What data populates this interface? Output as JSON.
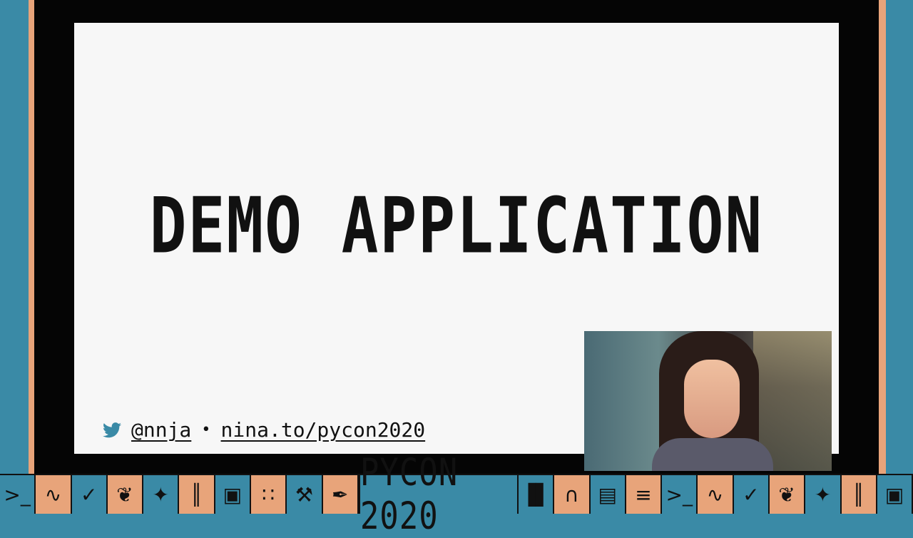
{
  "slide": {
    "title": "DEMO APPLICATION",
    "footer": {
      "twitter_handle": "@nnja",
      "separator": "•",
      "link": "nina.to/pycon2020"
    }
  },
  "branding": {
    "event_logo": "PYCON 2020"
  },
  "colors": {
    "teal": "#3a8aa6",
    "peach": "#e8a47a",
    "frame": "#050505",
    "slide_bg": "#f7f7f7",
    "twitter_blue": "#3a8aa6"
  },
  "icons": {
    "footer_icon": "twitter-icon",
    "bottom_bar_left": [
      "terminal-icon",
      "snake-icon",
      "check-icon",
      "laurel-icon",
      "star-icon",
      "pipes-icon",
      "robot-icon",
      "console-icon",
      "pipes-icon",
      "wrench-icon",
      "pen-icon",
      "bars-icon",
      "arch-icon",
      "gear-icon"
    ],
    "bottom_bar_right": [
      "arch-icon",
      "bars-icon",
      "window-icon",
      "terminal-icon",
      "snake-icon",
      "check-icon",
      "laurel-icon",
      "star-icon",
      "pipes-icon",
      "robot-icon"
    ]
  }
}
